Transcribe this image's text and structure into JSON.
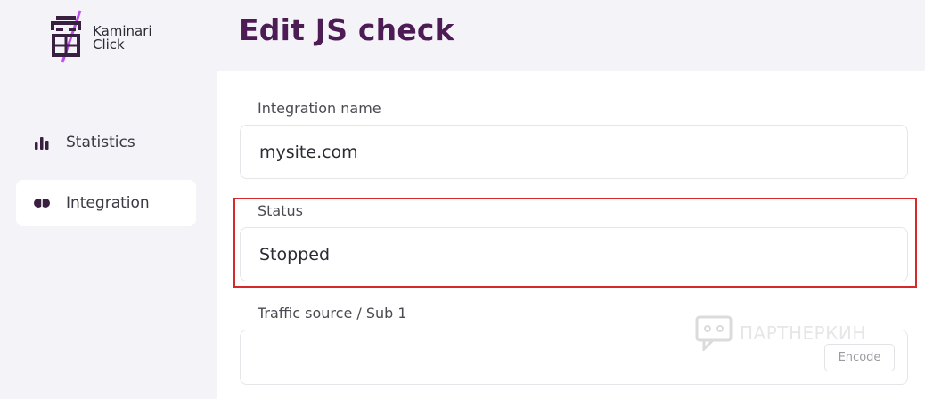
{
  "brand": {
    "name_line1": "Kaminari",
    "name_line2": "Click"
  },
  "page": {
    "title": "Edit JS check"
  },
  "sidebar": {
    "items": [
      {
        "label": "Statistics",
        "icon": "bar-chart-icon",
        "active": false
      },
      {
        "label": "Integration",
        "icon": "link-icon",
        "active": true
      }
    ]
  },
  "form": {
    "integration_name": {
      "label": "Integration name",
      "value": "mysite.com"
    },
    "status": {
      "label": "Status",
      "value": "Stopped"
    },
    "traffic_source": {
      "label": "Traffic source / Sub 1",
      "value": "",
      "encode_label": "Encode"
    }
  },
  "watermark": {
    "text": "ПАРТНЕРКИН",
    "icon": "chat-bubble-icon"
  },
  "colors": {
    "title": "#4d1c55",
    "accent": "#8e3cc8",
    "highlight": "#d42a2a"
  }
}
